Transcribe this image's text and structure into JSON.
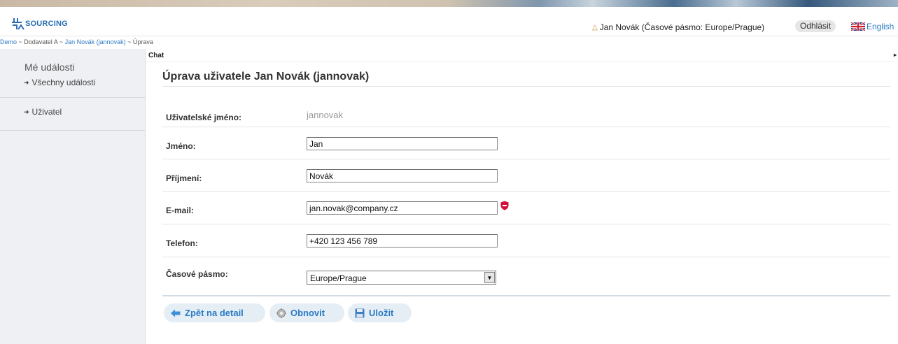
{
  "header": {
    "logo_text": "SOURCING",
    "user_label": "Jan Novák (Časové pásmo: Europe/Prague)",
    "logout_label": "Odhlásit",
    "language_label": "English"
  },
  "breadcrumb": {
    "items": [
      "Demo",
      "Dodavatel A",
      "Jan Novák (jannovak)",
      "Úprava"
    ],
    "separator": " ~ "
  },
  "sidebar": {
    "title": "Mé události",
    "items": [
      {
        "label": "Všechny události"
      },
      {
        "label": "Uživatel"
      }
    ]
  },
  "chat": {
    "label": "Chat"
  },
  "form": {
    "title": "Úprava uživatele Jan Novák (jannovak)",
    "username": {
      "label": "Uživatelské jméno:",
      "value": "jannovak"
    },
    "first_name": {
      "label": "Jméno:",
      "value": "Jan"
    },
    "last_name": {
      "label": "Příjmení:",
      "value": "Novák"
    },
    "email": {
      "label": "E-mail:",
      "value": "jan.novak@company.cz"
    },
    "phone": {
      "label": "Telefon:",
      "value": "+420 123 456 789"
    },
    "timezone": {
      "label": "Časové pásmo:",
      "value": "Europe/Prague"
    }
  },
  "actions": {
    "back_label": "Zpět na detail",
    "refresh_label": "Obnovit",
    "save_label": "Uložit"
  },
  "colors": {
    "accent": "#2b7bc4",
    "sidebar_bg": "#eef0f3",
    "button_bg": "#e6eef5",
    "warning": "#d0103a"
  }
}
